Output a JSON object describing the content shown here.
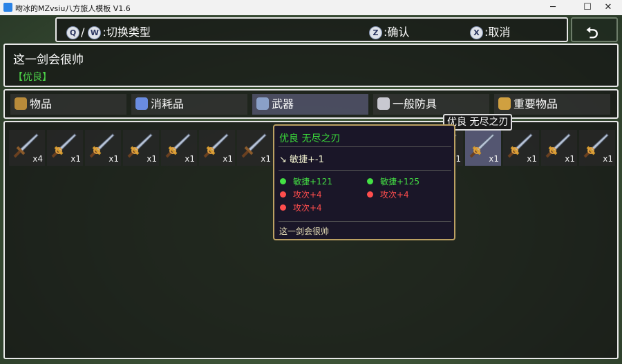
{
  "window": {
    "title": "吻冰的MZvsiu八方旅人模板 V1.6",
    "minimize": "─",
    "maximize": "☐",
    "close": "✕"
  },
  "help": {
    "q_key": "Q",
    "w_key": "W",
    "switch": "/",
    "switch_label": ":切换类型",
    "z_key": "Z",
    "confirm_label": ":确认",
    "x_key": "X",
    "cancel_label": ":取消"
  },
  "back_icon": "return-arrow-icon",
  "item_info": {
    "name": "这一剑会很帅",
    "rarity": "【优良】"
  },
  "categories": [
    {
      "label": "物品",
      "icon": "bag-icon",
      "color": "#b88b3a"
    },
    {
      "label": "消耗品",
      "icon": "potion-icon",
      "color": "#6a8ce0"
    },
    {
      "label": "武器",
      "icon": "weapon-icon",
      "color": "#8aa0c8"
    },
    {
      "label": "一般防具",
      "icon": "sword-armor-icon",
      "color": "#c8c8d0"
    },
    {
      "label": "重要物品",
      "icon": "key-icon",
      "color": "#d0a040"
    }
  ],
  "active_category": "武器",
  "slots": [
    {
      "count": "x4",
      "weapon": "sword"
    },
    {
      "count": "x1",
      "weapon": "gold-sword"
    },
    {
      "count": "x1",
      "weapon": "gold-sword"
    },
    {
      "count": "x1",
      "weapon": "gold-sword"
    },
    {
      "count": "x1",
      "weapon": "gold-sword"
    },
    {
      "count": "x1",
      "weapon": "gold-sword"
    },
    {
      "count": "x1",
      "weapon": "sword"
    },
    {
      "count": "x1",
      "weapon": "gold-sword"
    },
    {
      "count": "x1",
      "weapon": "gold-sword"
    },
    {
      "count": "x1",
      "weapon": "gold-sword"
    },
    {
      "count": "x1",
      "weapon": "gold-sword"
    },
    {
      "count": "x1",
      "weapon": "gold-sword"
    },
    {
      "count": "x1",
      "weapon": "gold-sword"
    },
    {
      "count": "x1",
      "weapon": "gold-sword"
    },
    {
      "count": "x1",
      "weapon": "gold-sword"
    },
    {
      "count": "x1",
      "weapon": "gold-sword"
    }
  ],
  "hover_label": "优良  无尽之刃",
  "tooltip": {
    "title": "优良  无尽之刃",
    "main_stat": "↘  敏捷+-1",
    "left_stats": [
      {
        "text": "敏捷+121",
        "color": "green"
      },
      {
        "text": "攻次+4",
        "color": "red"
      },
      {
        "text": "攻次+4",
        "color": "red"
      }
    ],
    "right_stats": [
      {
        "text": "敏捷+125",
        "color": "green"
      },
      {
        "text": "攻次+4",
        "color": "red"
      }
    ],
    "description": "这一剑会很帅"
  }
}
